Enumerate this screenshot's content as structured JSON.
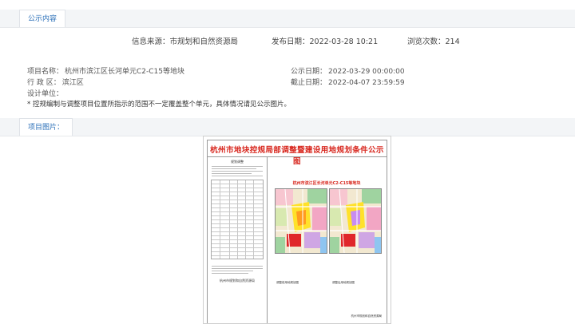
{
  "section1": {
    "tab_label": "公示内容"
  },
  "meta": {
    "source": "信息来源：市规划和自然资源局",
    "publish_date": "发布日期：2022-03-28 10:21",
    "views": "浏览次数：214"
  },
  "info": {
    "project_name_label": "项目名称：",
    "project_name_value": "杭州市滨江区长河单元C2-C15等地块",
    "district_label": "行 政 区：",
    "district_value": "滨江区",
    "designer_label": "设计单位：",
    "notice_date_label": "公示日期：",
    "notice_date_value": "2022-03-29 00:00:00",
    "deadline_label": "截止日期：",
    "deadline_value": "2022-04-07 23:59:59",
    "note": "* 控规编制与调整项目位置所指示的范围不一定覆盖整个单元，具体情况请见公示图片。"
  },
  "section2": {
    "tab_label": "项目图片："
  },
  "poster": {
    "title": "杭州市地块控规局部调整暨建设用地规划条件公示图",
    "subtitle": "规划调整",
    "map_caption": "杭州市滨江区长河单元C2-C15等地块",
    "map_left_label": "调整前用地规划图",
    "map_right_label": "调整后用地规划图",
    "org": "杭州市规划和自然资源局",
    "footer": "杭州市规划和自然资源局"
  }
}
